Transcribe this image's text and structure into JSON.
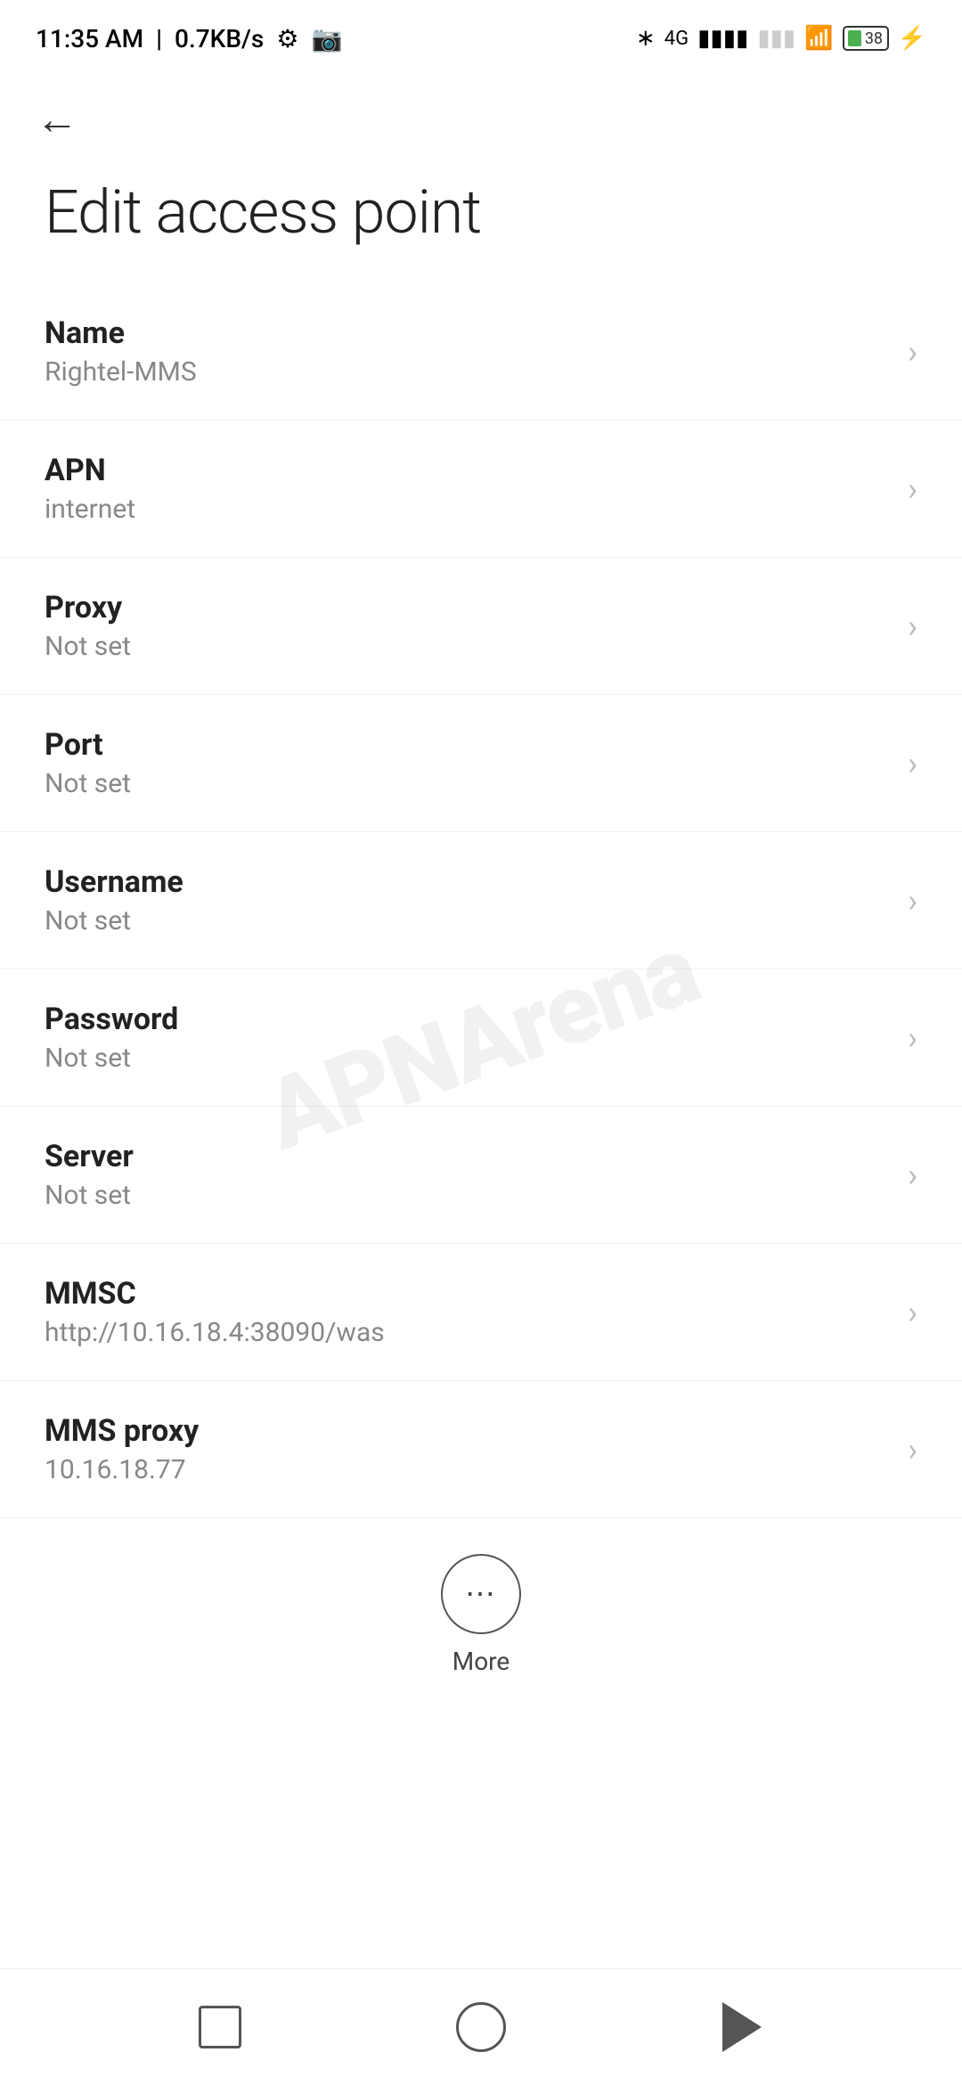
{
  "statusBar": {
    "time": "11:35 AM",
    "networkSpeed": "0.7KB/s"
  },
  "page": {
    "title": "Edit access point",
    "backLabel": "Back"
  },
  "settings": [
    {
      "id": "name",
      "title": "Name",
      "value": "Rightel-MMS"
    },
    {
      "id": "apn",
      "title": "APN",
      "value": "internet"
    },
    {
      "id": "proxy",
      "title": "Proxy",
      "value": "Not set"
    },
    {
      "id": "port",
      "title": "Port",
      "value": "Not set"
    },
    {
      "id": "username",
      "title": "Username",
      "value": "Not set"
    },
    {
      "id": "password",
      "title": "Password",
      "value": "Not set"
    },
    {
      "id": "server",
      "title": "Server",
      "value": "Not set"
    },
    {
      "id": "mmsc",
      "title": "MMSC",
      "value": "http://10.16.18.4:38090/was"
    },
    {
      "id": "mms-proxy",
      "title": "MMS proxy",
      "value": "10.16.18.77"
    }
  ],
  "more": {
    "label": "More"
  },
  "watermark": "APNArena"
}
